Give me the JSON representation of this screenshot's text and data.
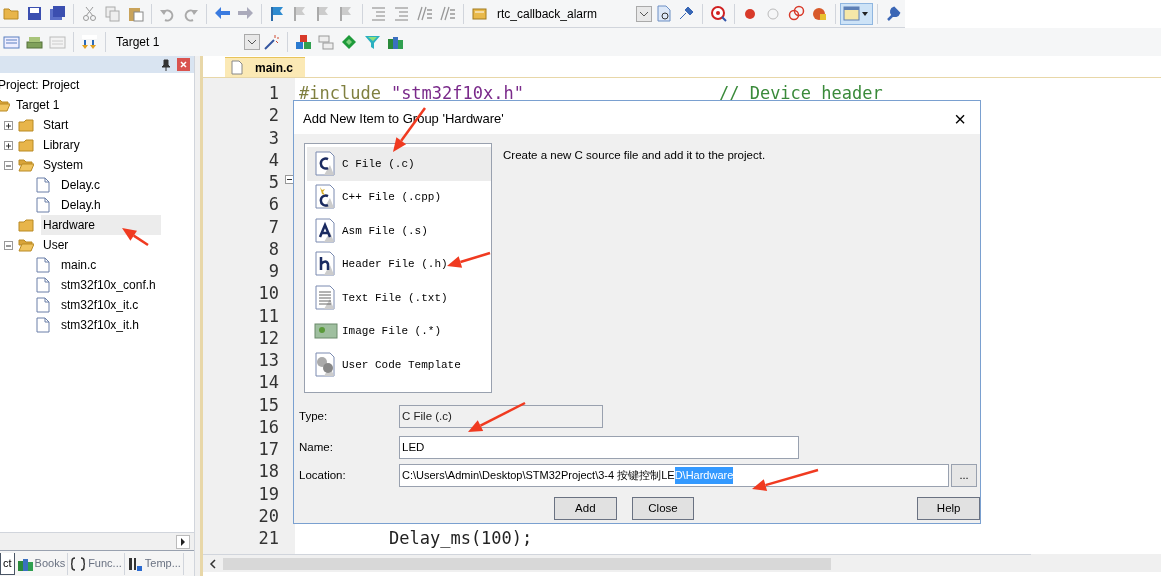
{
  "toolbar": {
    "function_dropdown": "rtc_callback_alarm",
    "target_dropdown": "Target 1"
  },
  "project_panel": {
    "title": "Project: Project",
    "tree": [
      {
        "label": "Target 1",
        "kind": "target",
        "expanded": true,
        "selected": false,
        "children": [
          {
            "label": "Start",
            "kind": "folder",
            "expanded": false,
            "selected": false
          },
          {
            "label": "Library",
            "kind": "folder",
            "expanded": false,
            "selected": false
          },
          {
            "label": "System",
            "kind": "folder",
            "expanded": true,
            "selected": false,
            "children": [
              {
                "label": "Delay.c",
                "kind": "file",
                "selected": false
              },
              {
                "label": "Delay.h",
                "kind": "file",
                "selected": false
              }
            ]
          },
          {
            "label": "Hardware",
            "kind": "folder",
            "selected": true
          },
          {
            "label": "User",
            "kind": "folder",
            "expanded": true,
            "selected": false,
            "children": [
              {
                "label": "main.c",
                "kind": "file",
                "selected": false
              },
              {
                "label": "stm32f10x_conf.h",
                "kind": "file",
                "selected": false
              },
              {
                "label": "stm32f10x_it.c",
                "kind": "file",
                "selected": false
              },
              {
                "label": "stm32f10x_it.h",
                "kind": "file",
                "selected": false
              }
            ]
          }
        ]
      }
    ],
    "tabs": [
      {
        "label": "ct",
        "selected": true
      },
      {
        "label": "Books",
        "selected": false
      },
      {
        "label": "Func...",
        "selected": false
      },
      {
        "label": "Temp...",
        "selected": false
      }
    ]
  },
  "editor": {
    "tabs": [
      {
        "label": "main.c",
        "selected": true
      }
    ],
    "lines": [
      {
        "number": "1",
        "parts": [
          {
            "kind": "directive",
            "text": "#include"
          },
          {
            "kind": "string",
            "text": "\"stm32f10x.h\""
          },
          {
            "kind": "comment",
            "text": "// Device header"
          }
        ]
      },
      {
        "number": "2"
      },
      {
        "number": "3"
      },
      {
        "number": "4"
      },
      {
        "number": "5"
      },
      {
        "number": "6"
      },
      {
        "number": "7"
      },
      {
        "number": "8"
      },
      {
        "number": "9"
      },
      {
        "number": "10"
      },
      {
        "number": "11"
      },
      {
        "number": "12"
      },
      {
        "number": "13"
      },
      {
        "number": "14"
      },
      {
        "number": "15"
      },
      {
        "number": "16"
      },
      {
        "number": "17"
      },
      {
        "number": "18"
      },
      {
        "number": "19"
      },
      {
        "number": "20"
      },
      {
        "number": "21",
        "parts": [
          {
            "kind": "code",
            "text": "Delay_ms(100);"
          }
        ]
      }
    ]
  },
  "dialog": {
    "title": "Add New Item to Group 'Hardware'",
    "close": "×",
    "items": [
      {
        "label": "C File (.c)",
        "kind": "c",
        "selected": true
      },
      {
        "label": "C++ File (.cpp)",
        "kind": "cpp",
        "selected": false
      },
      {
        "label": "Asm File (.s)",
        "kind": "asm",
        "selected": false
      },
      {
        "label": "Header File (.h)",
        "kind": "h",
        "selected": false
      },
      {
        "label": "Text File (.txt)",
        "kind": "txt",
        "selected": false
      },
      {
        "label": "Image File (.*)",
        "kind": "image",
        "selected": false
      },
      {
        "label": "User Code Template",
        "kind": "template",
        "selected": false
      }
    ],
    "description": "Create a new C source file and add it to the project.",
    "type": {
      "label": "Type:",
      "value": "C File (.c)",
      "disabled": true
    },
    "name": {
      "label": "Name:",
      "value": "LED"
    },
    "location": {
      "label": "Location:",
      "value": "C:\\Users\\Admin\\Desktop\\STM32Project\\3-4 按键控制LE",
      "selected_text": "D\\Hardware",
      "browse": "..."
    },
    "buttons": [
      "Add",
      "Close",
      "Help"
    ]
  }
}
